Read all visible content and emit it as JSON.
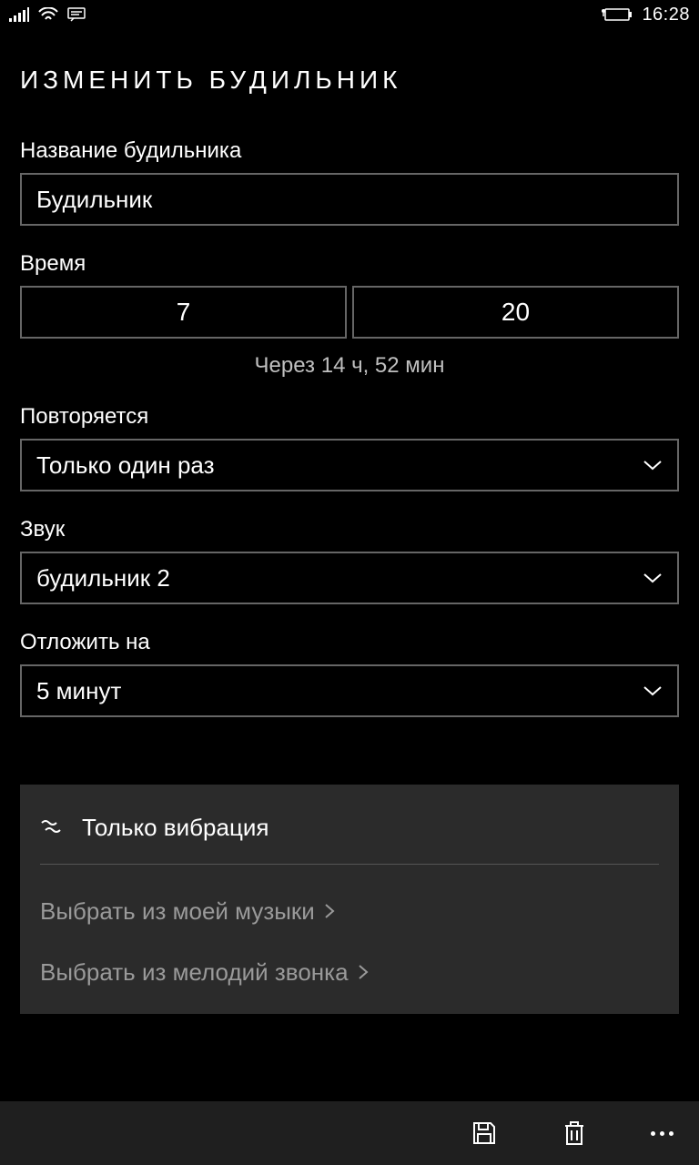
{
  "status": {
    "clock": "16:28"
  },
  "page": {
    "title": "ИЗМЕНИТЬ БУДИЛЬНИК"
  },
  "name": {
    "label": "Название будильника",
    "value": "Будильник"
  },
  "time": {
    "label": "Время",
    "hour": "7",
    "minute": "20",
    "hint": "Через 14 ч, 52 мин"
  },
  "repeat": {
    "label": "Повторяется",
    "value": "Только один раз"
  },
  "sound": {
    "label": "Звук",
    "value": "будильник 2"
  },
  "snooze": {
    "label": "Отложить на",
    "value": "5 минут"
  },
  "panel": {
    "vibration": "Только вибрация",
    "from_music": "Выбрать из моей музыки",
    "from_ringtones": "Выбрать из мелодий звонка"
  }
}
